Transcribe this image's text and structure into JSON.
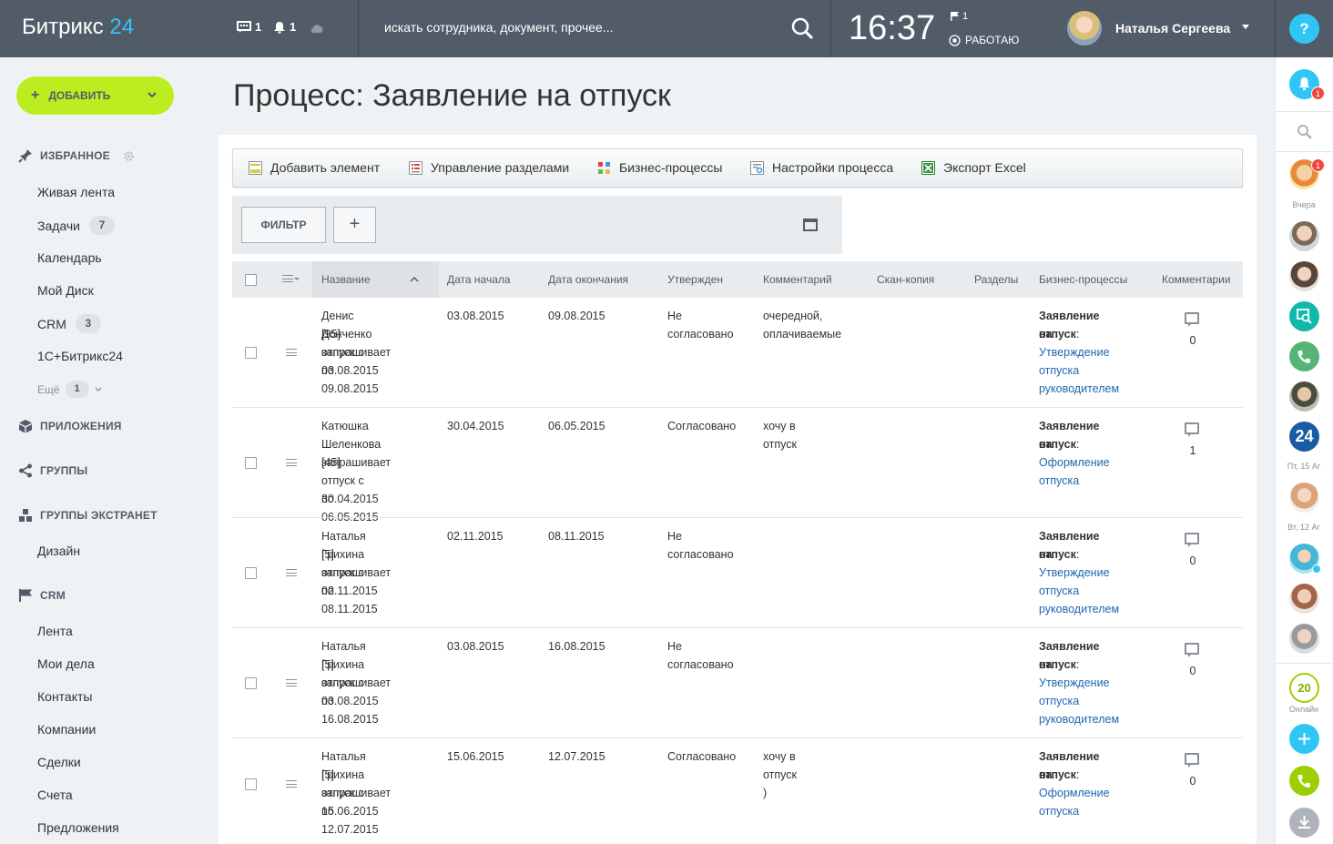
{
  "header": {
    "logo_main": "Битрикс",
    "logo_num": "24",
    "messages_count": "1",
    "notifications_count": "1",
    "search_placeholder": "искать сотрудника, документ, прочее...",
    "clock": "16:37",
    "flag_count": "1",
    "work_status": "РАБОТАЮ",
    "user_name": "Наталья Сергеева",
    "help": "?"
  },
  "sidebar": {
    "add_label": "ДОБАВИТЬ",
    "favorites_label": "ИЗБРАННОЕ",
    "favorites": [
      {
        "label": "Живая лента",
        "badge": ""
      },
      {
        "label": "Задачи",
        "badge": "7"
      },
      {
        "label": "Календарь",
        "badge": ""
      },
      {
        "label": "Мой Диск",
        "badge": ""
      },
      {
        "label": "CRM",
        "badge": "3"
      },
      {
        "label": "1С+Битрикс24",
        "badge": ""
      }
    ],
    "more_label": "Ещё",
    "more_badge": "1",
    "apps_label": "ПРИЛОЖЕНИЯ",
    "groups_label": "ГРУППЫ",
    "extranet_label": "ГРУППЫ ЭКСТРАНЕТ",
    "extranet_items": [
      "Дизайн"
    ],
    "crm_label": "CRM",
    "crm_items": [
      "Лента",
      "Мои дела",
      "Контакты",
      "Компании",
      "Сделки",
      "Счета",
      "Предложения"
    ]
  },
  "page": {
    "title": "Процесс: Заявление на отпуск"
  },
  "toolbar": {
    "add_element": "Добавить элемент",
    "manage_sections": "Управление разделами",
    "business_processes": "Бизнес-процессы",
    "process_settings": "Настройки процесса",
    "export_excel": "Экспорт Excel"
  },
  "filter": {
    "filter_label": "ФИЛЬТР",
    "plus_label": "+"
  },
  "grid": {
    "columns": [
      "Название",
      "Дата начала",
      "Дата окончания",
      "Утвержден",
      "Комментарий",
      "Скан-копия",
      "Разделы",
      "Бизнес-процессы",
      "Комментарии"
    ],
    "rows": [
      {
        "name": [
          "Денис Донченко",
          "[95] запрашивает",
          "отпуск с 03.08.2015",
          "по 09.08.2015"
        ],
        "start": "03.08.2015",
        "end": "09.08.2015",
        "approved": [
          "Не",
          "согласовано"
        ],
        "comment": [
          "очередной,",
          "оплачиваемые"
        ],
        "bp_title": [
          "Заявление на",
          "отпуск"
        ],
        "bp_link": [
          "Утверждение",
          "отпуска",
          "руководителем"
        ],
        "comments_count": "0"
      },
      {
        "name": [
          "Катюшка",
          "Шеленкова [45]",
          "запрашивает",
          "отпуск с 30.04.2015",
          "по 06.05.2015"
        ],
        "start": "30.04.2015",
        "end": "06.05.2015",
        "approved": [
          "Согласовано"
        ],
        "comment": [
          "хочу в отпуск"
        ],
        "bp_title": [
          "Заявление на",
          "отпуск"
        ],
        "bp_link": [
          "Оформление",
          "отпуска"
        ],
        "comments_count": "1"
      },
      {
        "name": [
          "Наталья Грихина",
          "[5] запрашивает",
          "отпуск с 02.11.2015",
          "по 08.11.2015"
        ],
        "start": "02.11.2015",
        "end": "08.11.2015",
        "approved": [
          "Не",
          "согласовано"
        ],
        "comment": [],
        "bp_title": [
          "Заявление на",
          "отпуск"
        ],
        "bp_link": [
          "Утверждение",
          "отпуска",
          "руководителем"
        ],
        "comments_count": "0"
      },
      {
        "name": [
          "Наталья Грихина",
          "[5] запрашивает",
          "отпуск с 03.08.2015",
          "по 16.08.2015"
        ],
        "start": "03.08.2015",
        "end": "16.08.2015",
        "approved": [
          "Не",
          "согласовано"
        ],
        "comment": [],
        "bp_title": [
          "Заявление на",
          "отпуск"
        ],
        "bp_link": [
          "Утверждение",
          "отпуска",
          "руководителем"
        ],
        "comments_count": "0"
      },
      {
        "name": [
          "Наталья Грихина",
          "[5] запрашивает",
          "отпуск с 15.06.2015",
          "по 12.07.2015"
        ],
        "start": "15.06.2015",
        "end": "12.07.2015",
        "approved": [
          "Согласовано"
        ],
        "comment": [
          "хочу в отпуск )"
        ],
        "bp_title": [
          "Заявление на",
          "отпуск"
        ],
        "bp_link": [
          "Оформление",
          "отпуска"
        ],
        "comments_count": "0"
      }
    ]
  },
  "rightbar": {
    "notif_badge": "1",
    "chat_badge": "1",
    "label_yesterday": "Вчера",
    "label_fri": "Пт, 15 Аг",
    "label_tue": "Вт, 12 Аг",
    "online_count": "20",
    "online_label": "Онлайн",
    "b24_label": "24"
  },
  "colors": {
    "header_bg": "#525c69",
    "accent_blue": "#2fc6f6",
    "add_green": "#bbed21",
    "link_blue": "#2067b0"
  }
}
